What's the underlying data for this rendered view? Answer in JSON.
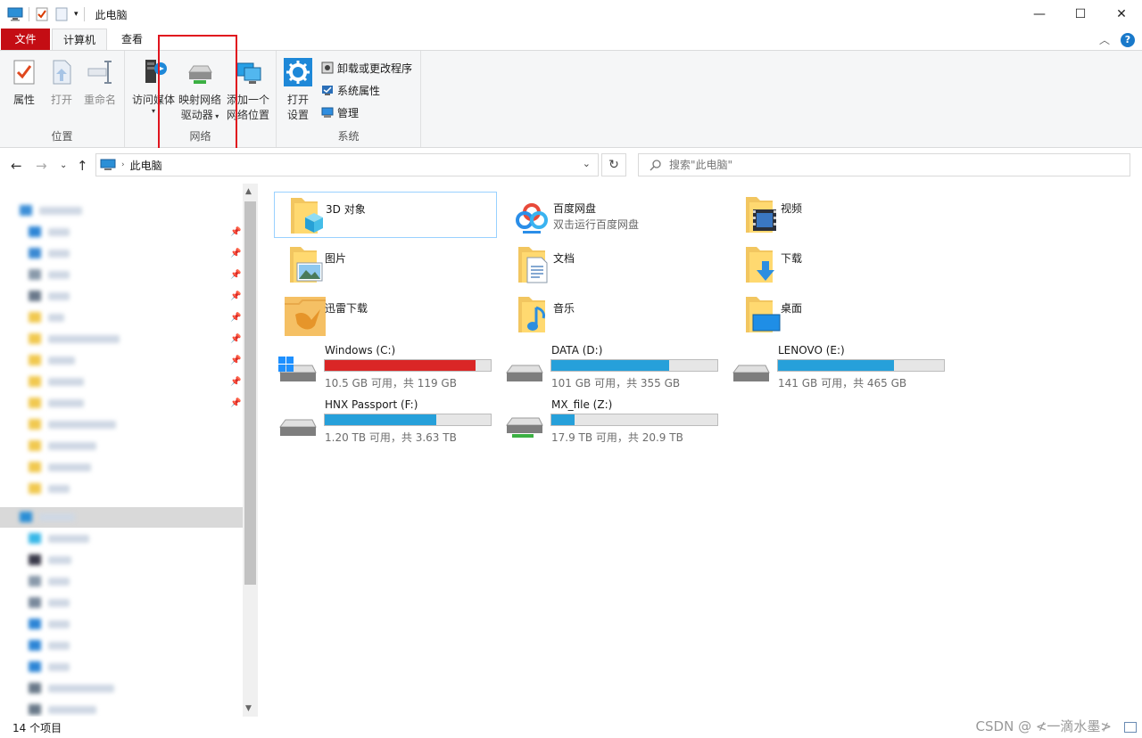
{
  "window": {
    "title": "此电脑",
    "minimize": "—",
    "maximize": "☐",
    "close": "✕"
  },
  "tabs": {
    "file": "文件",
    "computer": "计算机",
    "view": "查看"
  },
  "ribbon": {
    "location": {
      "label": "位置",
      "properties": "属性",
      "open": "打开",
      "rename": "重命名"
    },
    "network": {
      "label": "网络",
      "access_media_1": "访问媒体",
      "map_drive_1": "映射网络",
      "map_drive_2": "驱动器",
      "add_location_1": "添加一个",
      "add_location_2": "网络位置"
    },
    "system": {
      "label": "系统",
      "open_settings_1": "打开",
      "open_settings_2": "设置",
      "uninstall": "卸载或更改程序",
      "system_properties": "系统属性",
      "manage": "管理"
    }
  },
  "address": {
    "path": "此电脑",
    "search_placeholder": "搜索\"此电脑\""
  },
  "folders": [
    {
      "name": "3D 对象",
      "sub": ""
    },
    {
      "name": "百度网盘",
      "sub": "双击运行百度网盘"
    },
    {
      "name": "视频",
      "sub": ""
    },
    {
      "name": "图片",
      "sub": ""
    },
    {
      "name": "文档",
      "sub": ""
    },
    {
      "name": "下载",
      "sub": ""
    },
    {
      "name": "迅雷下载",
      "sub": ""
    },
    {
      "name": "音乐",
      "sub": ""
    },
    {
      "name": "桌面",
      "sub": ""
    }
  ],
  "drives": [
    {
      "name": "Windows (C:)",
      "space": "10.5 GB 可用，共 119 GB",
      "used_fraction": 0.91,
      "low": true
    },
    {
      "name": "DATA (D:)",
      "space": "101 GB 可用，共 355 GB",
      "used_fraction": 0.71,
      "low": false
    },
    {
      "name": "LENOVO (E:)",
      "space": "141 GB 可用，共 465 GB",
      "used_fraction": 0.7,
      "low": false
    },
    {
      "name": "HNX Passport (F:)",
      "space": "1.20 TB 可用，共 3.63 TB",
      "used_fraction": 0.67,
      "low": false
    },
    {
      "name": "MX_file (Z:)",
      "space": "17.9 TB 可用，共 20.9 TB",
      "used_fraction": 0.14,
      "low": false
    }
  ],
  "status": {
    "count": "14 个项目",
    "watermark": "CSDN @ ≮一滴水墨≯"
  },
  "colors": {
    "file_tab": "#c40d14",
    "drive_fill": "#26a0da",
    "drive_low": "#da2626",
    "highlight": "#e0141e"
  }
}
